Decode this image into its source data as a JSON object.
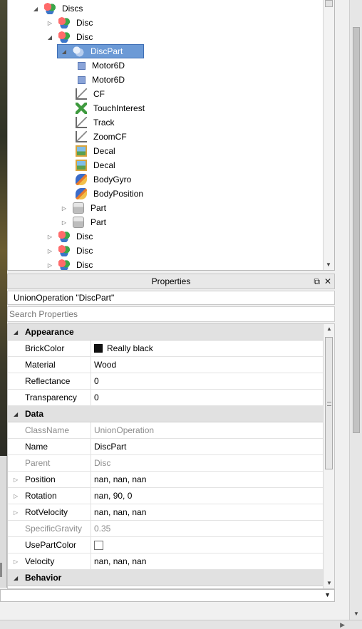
{
  "explorer": {
    "tree": [
      {
        "label": "Discs",
        "icon": "union-icon",
        "arrow": "expanded",
        "depth": 0
      },
      {
        "label": "Disc",
        "icon": "union-icon",
        "arrow": "collapsed",
        "depth": 1
      },
      {
        "label": "Disc",
        "icon": "union-icon",
        "arrow": "expanded",
        "depth": 1
      },
      {
        "label": "DiscPart",
        "icon": "union-icon",
        "arrow": "expanded",
        "depth": 2,
        "selected": true
      },
      {
        "label": "Motor6D",
        "icon": "motor6d-icon",
        "arrow": "none",
        "depth": 3
      },
      {
        "label": "Motor6D",
        "icon": "motor6d-icon",
        "arrow": "none",
        "depth": 3
      },
      {
        "label": "CF",
        "icon": "cframe-value-icon",
        "arrow": "none",
        "depth": 3
      },
      {
        "label": "TouchInterest",
        "icon": "touch-interest-icon",
        "arrow": "none",
        "depth": 3
      },
      {
        "label": "Track",
        "icon": "cframe-value-icon",
        "arrow": "none",
        "depth": 3
      },
      {
        "label": "ZoomCF",
        "icon": "cframe-value-icon",
        "arrow": "none",
        "depth": 3
      },
      {
        "label": "Decal",
        "icon": "decal-icon",
        "arrow": "none",
        "depth": 3
      },
      {
        "label": "Decal",
        "icon": "decal-icon",
        "arrow": "none",
        "depth": 3
      },
      {
        "label": "BodyGyro",
        "icon": "body-mover-icon",
        "arrow": "none",
        "depth": 3
      },
      {
        "label": "BodyPosition",
        "icon": "body-mover-icon",
        "arrow": "none",
        "depth": 3
      },
      {
        "label": "Part",
        "icon": "part-icon",
        "arrow": "collapsed",
        "depth": 2
      },
      {
        "label": "Part",
        "icon": "part-icon",
        "arrow": "collapsed",
        "depth": 2
      },
      {
        "label": "Disc",
        "icon": "union-icon",
        "arrow": "collapsed",
        "depth": 1
      },
      {
        "label": "Disc",
        "icon": "union-icon",
        "arrow": "collapsed",
        "depth": 1
      },
      {
        "label": "Disc",
        "icon": "union-icon",
        "arrow": "collapsed",
        "depth": 1
      }
    ]
  },
  "properties": {
    "title": "Properties",
    "object_label": "UnionOperation \"DiscPart\"",
    "search_placeholder": "Search Properties",
    "rows": [
      {
        "type": "category",
        "name": "Appearance"
      },
      {
        "type": "prop",
        "name": "BrickColor",
        "value": "Really black",
        "swatch": "#111111"
      },
      {
        "type": "prop",
        "name": "Material",
        "value": "Wood"
      },
      {
        "type": "prop",
        "name": "Reflectance",
        "value": "0"
      },
      {
        "type": "prop",
        "name": "Transparency",
        "value": "0"
      },
      {
        "type": "category",
        "name": "Data"
      },
      {
        "type": "prop",
        "name": "ClassName",
        "value": "UnionOperation",
        "readonly": true
      },
      {
        "type": "prop",
        "name": "Name",
        "value": "DiscPart"
      },
      {
        "type": "prop",
        "name": "Parent",
        "value": "Disc",
        "readonly": true
      },
      {
        "type": "prop",
        "name": "Position",
        "value": "nan, nan, nan",
        "expandable": true
      },
      {
        "type": "prop",
        "name": "Rotation",
        "value": "nan, 90, 0",
        "expandable": true
      },
      {
        "type": "prop",
        "name": "RotVelocity",
        "value": "nan, nan, nan",
        "expandable": true
      },
      {
        "type": "prop",
        "name": "SpecificGravity",
        "value": "0.35",
        "readonly": true
      },
      {
        "type": "prop",
        "name": "UsePartColor",
        "value": "",
        "checkbox": true,
        "checked": false
      },
      {
        "type": "prop",
        "name": "Velocity",
        "value": "nan, nan, nan",
        "expandable": true
      },
      {
        "type": "category",
        "name": "Behavior"
      }
    ]
  }
}
